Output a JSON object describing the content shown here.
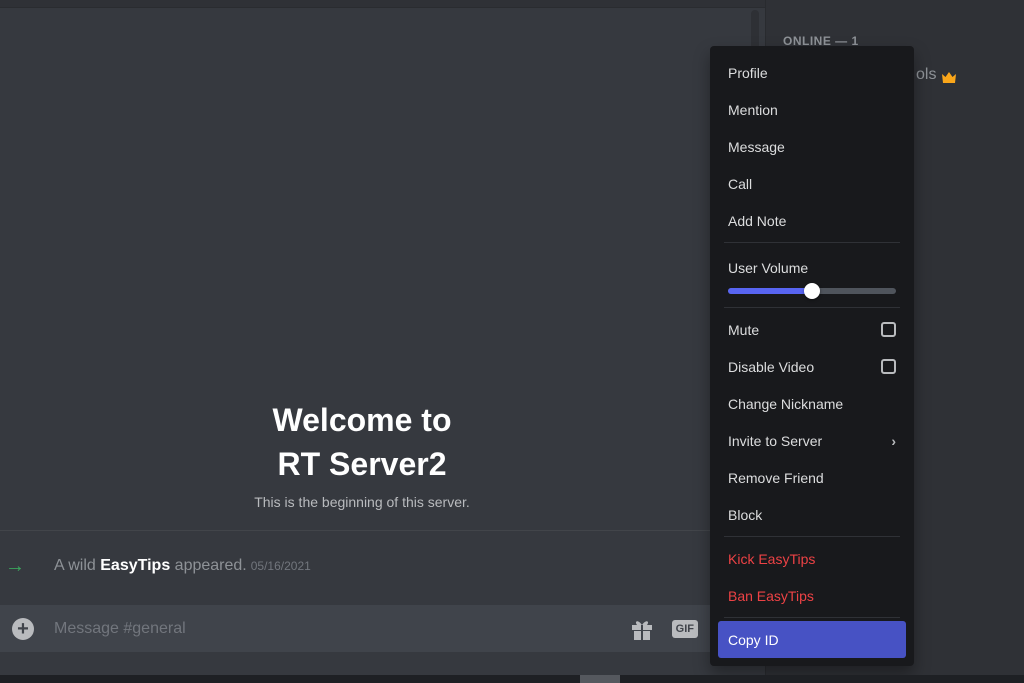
{
  "chat": {
    "welcome_line1": "Welcome to",
    "welcome_line2": "RT Server2",
    "welcome_sub": "This is the beginning of this server.",
    "system_message": {
      "icon": "arrow-right-icon",
      "prefix": "A wild ",
      "user": "EasyTips",
      "suffix": " appeared.",
      "timestamp": "05/16/2021"
    },
    "composer": {
      "placeholder": "Message #general",
      "gif_label": "GIF"
    }
  },
  "members": {
    "header": "ONLINE — 1",
    "visible_name_fragment": "ols",
    "owner_icon": "crown-icon"
  },
  "context_menu": {
    "items_top": [
      {
        "label": "Profile"
      },
      {
        "label": "Mention"
      },
      {
        "label": "Message"
      },
      {
        "label": "Call"
      },
      {
        "label": "Add Note"
      }
    ],
    "volume": {
      "label": "User Volume",
      "value_percent": 50
    },
    "toggles": [
      {
        "label": "Mute",
        "checked": false
      },
      {
        "label": "Disable Video",
        "checked": false
      }
    ],
    "items_mid": [
      {
        "label": "Change Nickname"
      },
      {
        "label": "Invite to Server",
        "submenu": true
      },
      {
        "label": "Remove Friend"
      },
      {
        "label": "Block"
      }
    ],
    "danger": [
      {
        "label": "Kick EasyTips"
      },
      {
        "label": "Ban EasyTips"
      }
    ],
    "copy_id": "Copy ID"
  },
  "colors": {
    "accent": "#5865f2",
    "active_item": "#4752c4",
    "danger": "#ed4245",
    "join_arrow": "#3ba55d",
    "crown": "#faa61a"
  }
}
